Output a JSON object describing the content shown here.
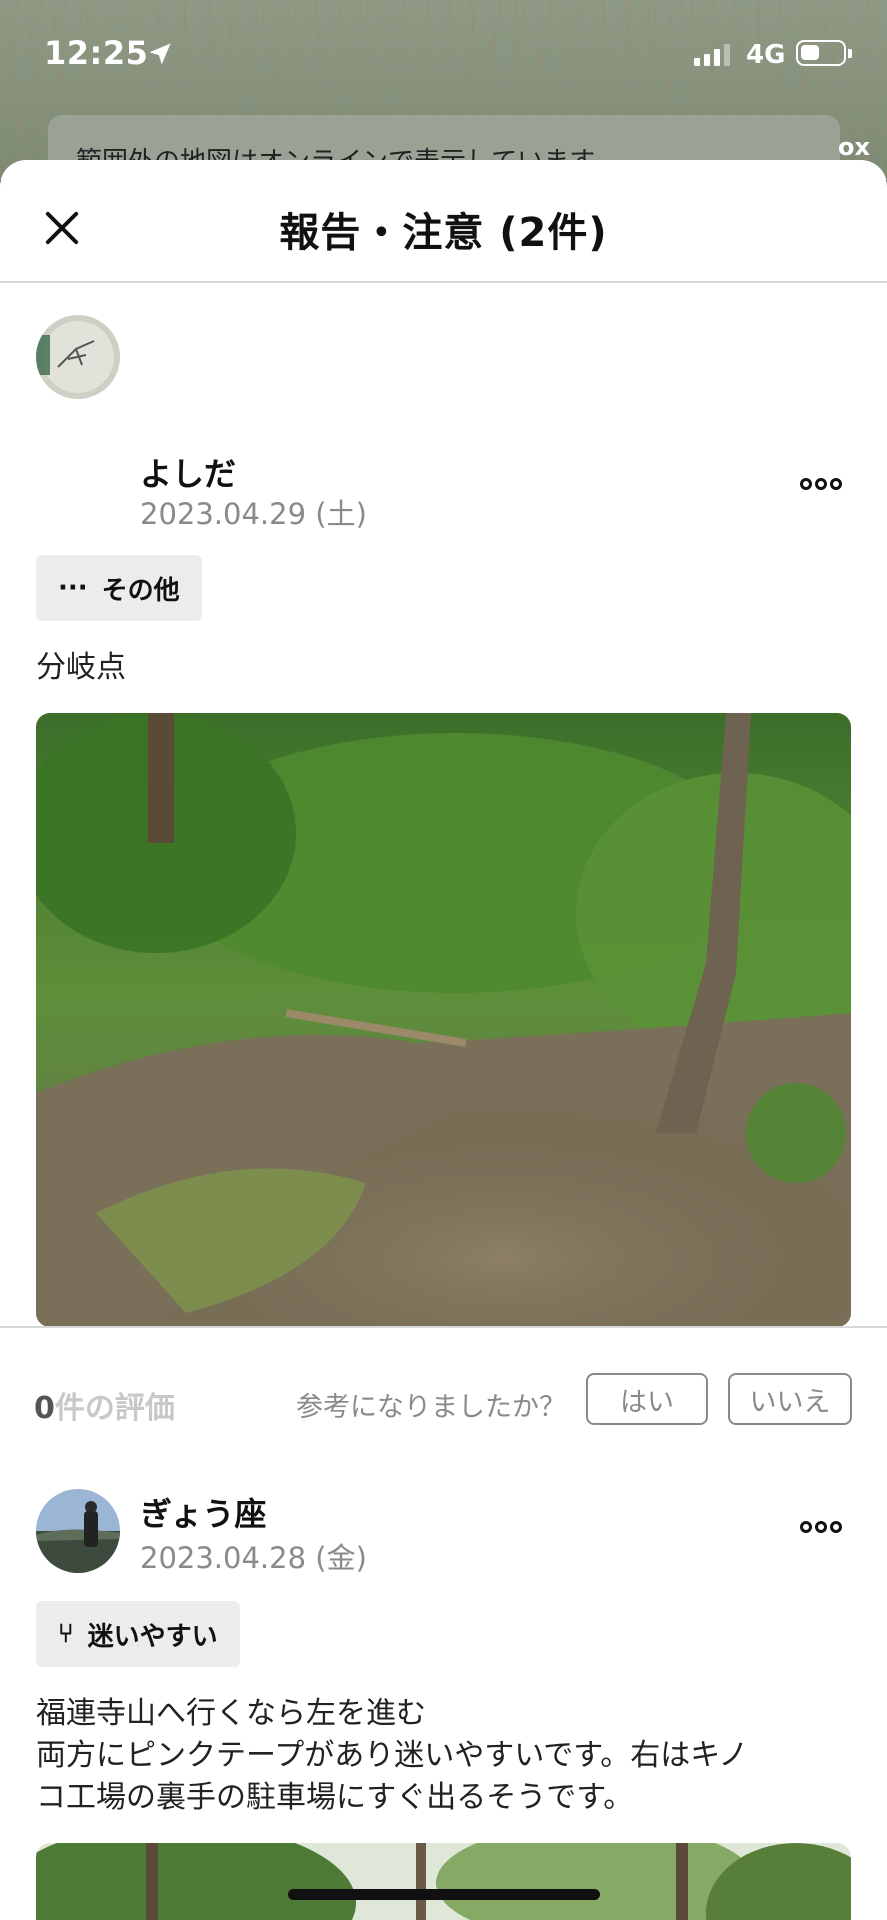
{
  "status_bar": {
    "time": "12:25",
    "network": "4G",
    "battery_level": 0.45
  },
  "map_banner": {
    "text": "範囲外の地図はオンラインで表示しています",
    "mapbox_text": "ox"
  },
  "sheet": {
    "title": "報告・注意 (2件)"
  },
  "reports": [
    {
      "user": "よしだ",
      "date": "2023.04.29 (土)",
      "tag": {
        "icon": "ellipsis-icon",
        "icon_text": "···",
        "label": "その他"
      },
      "text": "分岐点",
      "rating_count": "0",
      "rating_suffix": "件の評価",
      "helpful_question": "参考になりましたか？",
      "yes_label": "はい",
      "no_label": "いいえ"
    },
    {
      "user": "ぎょう座",
      "date": "2023.04.28 (金)",
      "tag": {
        "icon": "fork-lost-icon",
        "icon_text": "⑂",
        "label": "迷いやすい"
      },
      "text_lines": [
        "福連寺山へ行くなら左を進む",
        "両方にピンクテープがあり迷いやすいです。右はキノ",
        "コ工場の裏手の駐車場にすぐ出るそうです。"
      ]
    }
  ],
  "colors": {
    "sheet_bg": "#ffffff",
    "muted_text": "#8a8a8a",
    "tag_bg": "#ececec",
    "forest_green": "#3f7a2c"
  }
}
